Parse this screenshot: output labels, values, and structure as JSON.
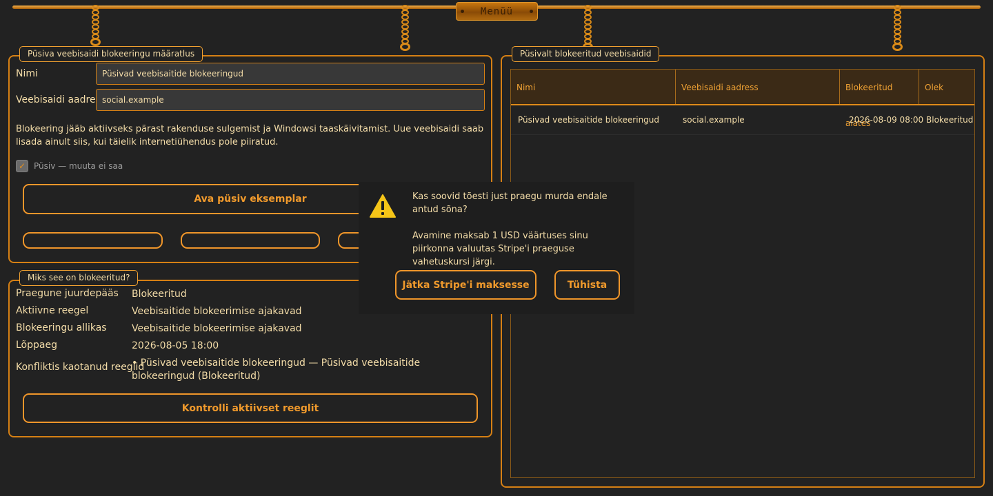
{
  "menu": {
    "label": "Menüü"
  },
  "definition": {
    "title": "Püsiva veebisaidi blokeeringu määratlus",
    "name_label": "Nimi",
    "name_value": "Püsivad veebisaitide blokeeringud",
    "address_label": "Veebisaidi aadress",
    "address_value": "social.example",
    "description": "Blokeering jääb aktiivseks pärast rakenduse sulgemist ja Windowsi taaskäivitamist. Uue veebisaidi saab lisada ainult siis, kui täielik internetiühendus pole piiratud.",
    "checkbox_label": "Püsiv — muuta ei saa",
    "checkbox_checked": true,
    "open_button": "Ava püsiv eksemplar"
  },
  "why": {
    "title": "Miks see on blokeeritud?",
    "rows": [
      {
        "key": "Praegune juurdepääs",
        "value": "Blokeeritud"
      },
      {
        "key": "Aktiivne reegel",
        "value": "Veebisaitide blokeerimise ajakavad"
      },
      {
        "key": "Blokeeringu allikas",
        "value": "Veebisaitide blokeerimise ajakavad"
      },
      {
        "key": "Lõppaeg",
        "value": "2026-08-05 18:00"
      },
      {
        "key": "Konfliktis kaotanud reeglid",
        "value": "• Püsivad veebisaitide blokeeringud — Püsivad veebisaitide blokeeringud (Blokeeritud)"
      }
    ],
    "check_button": "Kontrolli aktiivset reeglit"
  },
  "blocked": {
    "title": "Püsivalt blokeeritud veebisaidid",
    "columns": [
      "Nimi",
      "Veebisaidi aadress",
      "Blokeeritud alates",
      "Olek"
    ],
    "rows": [
      [
        "Püsivad veebisaitide blokeeringud",
        "social.example",
        "2026-08-09 08:00",
        "Blokeeritud"
      ]
    ]
  },
  "dialog": {
    "icon": "warning-icon",
    "question": "Kas soovid tõesti just praegu murda endale antud sõna?",
    "detail": "Avamine maksab 1 USD väärtuses sinu piirkonna valuutas Stripe'i praeguse vahetuskursi järgi.",
    "continue_button": "Jätka Stripe'i maksesse",
    "cancel_button": "Tühista"
  },
  "colors": {
    "accent": "#f0962a",
    "background": "#222222",
    "text": "#f3dca8",
    "warning": "#f5c518"
  }
}
